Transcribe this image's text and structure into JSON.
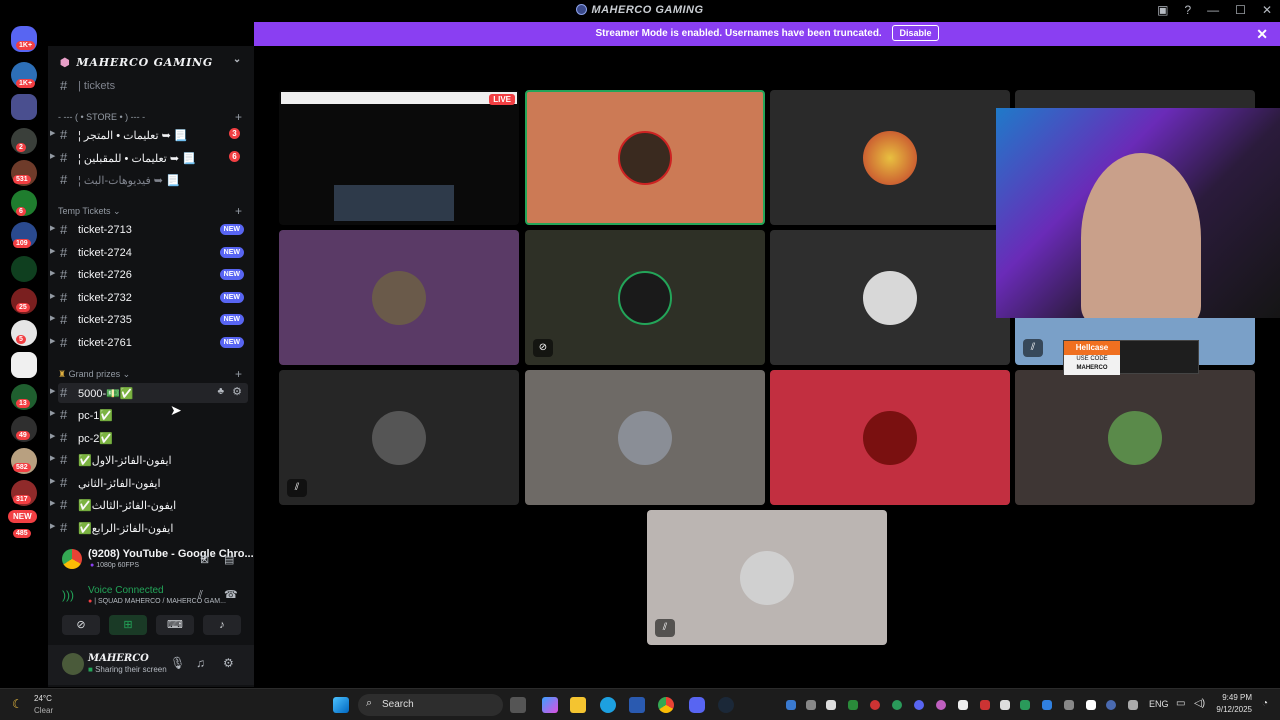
{
  "window": {
    "title": "MAHERCO GAMING"
  },
  "banner": {
    "text": "Streamer Mode is enabled. Usernames have been truncated.",
    "button": "Disable"
  },
  "servers": {
    "badges": [
      "1K+",
      "1K+",
      "2",
      "531",
      "6",
      "109",
      "25",
      "5",
      "13",
      "49",
      "582",
      "317",
      "NEW",
      "485"
    ]
  },
  "guild": {
    "name": "MAHERCO GAMING"
  },
  "channels": {
    "tickets": "| tickets",
    "store_category": "- --- ( • STORE • ) --- -",
    "store": [
      {
        "name": "¦ تعليمات • المتجر ➥ 📃",
        "badge": "3"
      },
      {
        "name": "¦ تعليمات • للمقبلين ➥ 📃",
        "badge": "6"
      },
      {
        "name": "¦ فيديوهات-البث ➥ 📃",
        "badge": ""
      }
    ],
    "temp_category": "Temp Tickets",
    "tickets_list": [
      {
        "name": "ticket-2713",
        "badge": "NEW"
      },
      {
        "name": "ticket-2724",
        "badge": "NEW"
      },
      {
        "name": "ticket-2726",
        "badge": "NEW"
      },
      {
        "name": "ticket-2732",
        "badge": "NEW"
      },
      {
        "name": "ticket-2735",
        "badge": "NEW"
      },
      {
        "name": "ticket-2761",
        "badge": "NEW"
      }
    ],
    "prizes_category": "Grand prizes",
    "prizes": [
      {
        "name": "5000-💵✅"
      },
      {
        "name": "pc-1✅"
      },
      {
        "name": "pc-2✅"
      },
      {
        "name": "✅ايفون-الفائز-الاول"
      },
      {
        "name": "ايفون-الفائز-الثاني"
      },
      {
        "name": "✅ايفون-الفائز-الثالث"
      },
      {
        "name": "✅ايفون-الفائز-الرابع"
      }
    ]
  },
  "stream": {
    "title": "(9208) YouTube - Google Chro...",
    "quality": "1080p 60FPS"
  },
  "voice": {
    "status": "Voice Connected",
    "channel": "| SQUAD MAHERCO / MAHERCO GAM..."
  },
  "user": {
    "name": "MAHERCO",
    "status": "Sharing their screen"
  },
  "grid": {
    "live_badge": "LIVE"
  },
  "sponsor": {
    "brand": "Hellcase",
    "line1": "USE CODE",
    "line2": "MAHERCO"
  },
  "taskbar": {
    "weather_temp": "24°C",
    "weather_desc": "Clear",
    "search": "Search",
    "lang": "ENG",
    "time": "9:49 PM",
    "date": "9/12/2025"
  },
  "colors": {
    "accent": "#8a3ff2",
    "new_badge": "#5865f2",
    "alert": "#f23f43",
    "voice_green": "#23a559"
  }
}
